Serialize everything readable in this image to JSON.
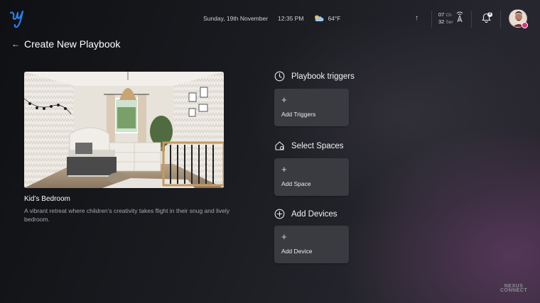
{
  "header": {
    "date": "Sunday, 19th November",
    "time": "12:35 PM",
    "temperature": "64°F",
    "weather_icon": "partly-cloudy-icon",
    "arrow_icon": "arrow-up-icon",
    "status_top_value": "07",
    "status_top_unit": "Ch",
    "status_bottom_value": "32",
    "status_bottom_unit": "Ser",
    "notification_count": "0"
  },
  "page": {
    "title": "Create New Playbook",
    "back_icon": "back-arrow-icon"
  },
  "room": {
    "title": "Kid’s Bedroom",
    "description": "A vibrant retreat where children’s creativity takes flight in their snug and lively bedroom."
  },
  "sections": {
    "triggers": {
      "heading": "Playbook triggers",
      "add_label": "Add Triggers",
      "icon": "clock-icon"
    },
    "spaces": {
      "heading": "Select Spaces",
      "add_label": "Add Space",
      "icon": "home-icon"
    },
    "devices": {
      "heading": "Add Devices",
      "add_label": "Add Device",
      "icon": "plus-circle-icon"
    }
  },
  "brand": {
    "line1": "NEXUS",
    "line2": "CONNECT"
  },
  "colors": {
    "card_bg": "#3a3b40",
    "text_muted": "#a5a7ad",
    "avatar_badge": "#d2357d",
    "logo_blue": "#2f7ce6"
  }
}
